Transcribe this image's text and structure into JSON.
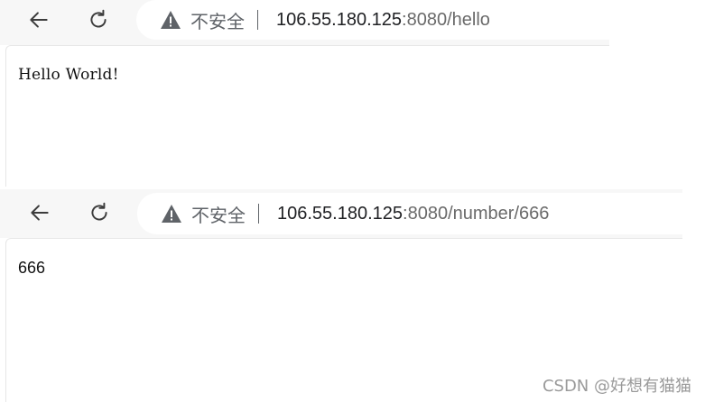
{
  "top_window": {
    "security_label": "不安全",
    "url_host": "106.55.180.125",
    "url_rest": ":8080/hello",
    "page_text": "Hello World!"
  },
  "bottom_window": {
    "security_label": "不安全",
    "url_host": "106.55.180.125",
    "url_rest": ":8080/number/666",
    "page_text": "666"
  },
  "icons": {
    "back": "back-arrow-icon",
    "reload": "reload-icon",
    "security": "warning-triangle-icon"
  },
  "watermark": "CSDN @好想有猫猫",
  "colors": {
    "toolbar_bg": "#f7f7f7",
    "icon": "#5f6368",
    "url_host": "#202124",
    "url_rest": "#6a6a6a"
  }
}
